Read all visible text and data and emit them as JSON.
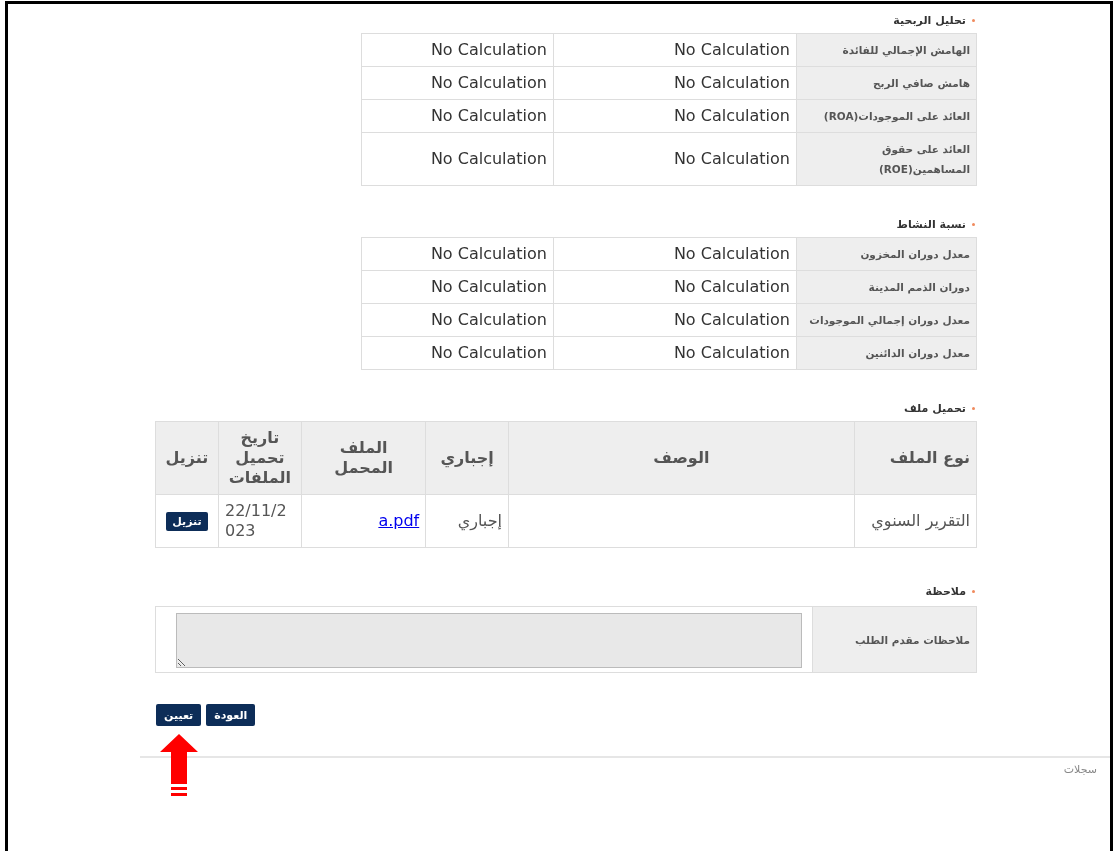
{
  "sections": [
    {
      "kind": "metrics",
      "title": "تحليل الربحية",
      "rows": [
        {
          "label": "الهامش الإجمالي للفائدة",
          "values": [
            "No Calculation",
            "No Calculation"
          ]
        },
        {
          "label": "هامش صافي الربح",
          "values": [
            "No Calculation",
            "No Calculation"
          ]
        },
        {
          "label": "العائد على الموجودات(ROA)",
          "values": [
            "No Calculation",
            "No Calculation"
          ]
        },
        {
          "label": "العائد على حقوق المساهمين(ROE)",
          "values": [
            "No Calculation",
            "No Calculation"
          ]
        }
      ]
    },
    {
      "kind": "metrics",
      "title": "نسبة النشاط",
      "rows": [
        {
          "label": "معدل دوران المخزون",
          "values": [
            "No Calculation",
            "No Calculation"
          ]
        },
        {
          "label": "دوران الذمم المدينة",
          "values": [
            "No Calculation",
            "No Calculation"
          ]
        },
        {
          "label": "معدل دوران إجمالي الموجودات",
          "values": [
            "No Calculation",
            "No Calculation"
          ]
        },
        {
          "label": "معدل دوران الدائنين",
          "values": [
            "No Calculation",
            "No Calculation"
          ]
        }
      ]
    },
    {
      "kind": "files",
      "title": "تحميل ملف",
      "columns": [
        "نوع الملف",
        "الوصف",
        "إجباري",
        "الملف المحمل",
        "تاريخ تحميل الملفات",
        "تنزيل"
      ],
      "rows": [
        {
          "type": "التقرير السنوي",
          "mandatory": "إجباري",
          "file": "a.pdf",
          "date": "22/11/2023",
          "download": "تنزيل"
        }
      ]
    },
    {
      "kind": "notes",
      "title": "ملاحظة",
      "label": "ملاحظات مقدم الطلب"
    }
  ],
  "buttons": [
    "العودة",
    "تعيين"
  ],
  "footer_link": "سجلات"
}
